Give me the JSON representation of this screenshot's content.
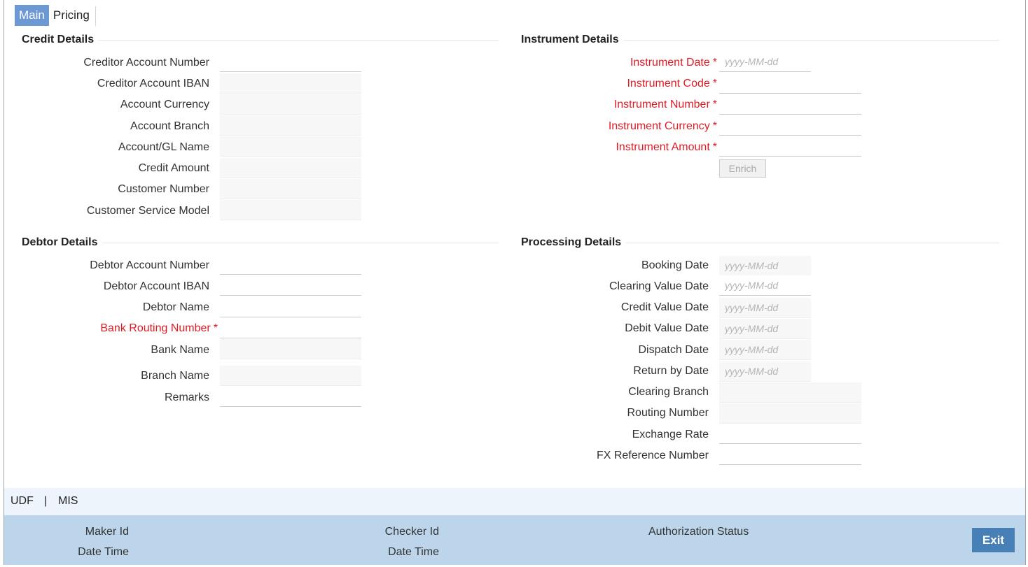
{
  "tabs": [
    {
      "label": "Main",
      "active": true
    },
    {
      "label": "Pricing",
      "active": false
    }
  ],
  "credit": {
    "title": "Credit Details",
    "fields": [
      {
        "label": "Creditor Account Number"
      },
      {
        "label": "Creditor Account IBAN"
      },
      {
        "label": "Account Currency"
      },
      {
        "label": "Account Branch"
      },
      {
        "label": "Account/GL Name"
      },
      {
        "label": "Credit Amount"
      },
      {
        "label": "Customer Number"
      },
      {
        "label": "Customer Service Model"
      }
    ]
  },
  "instrument": {
    "title": "Instrument Details",
    "required_marker": "*",
    "fields": [
      {
        "label": "Instrument Date",
        "placeholder": "yyyy-MM-dd"
      },
      {
        "label": "Instrument Code"
      },
      {
        "label": "Instrument Number"
      },
      {
        "label": "Instrument Currency"
      },
      {
        "label": "Instrument Amount"
      }
    ],
    "enrich_label": "Enrich"
  },
  "debtor": {
    "title": "Debtor Details",
    "fields": [
      {
        "label": "Debtor Account Number"
      },
      {
        "label": "Debtor Account IBAN"
      },
      {
        "label": "Debtor Name"
      },
      {
        "label": "Bank Routing Number"
      },
      {
        "label": "Bank Name"
      },
      {
        "label": "Branch Name"
      },
      {
        "label": "Remarks"
      }
    ]
  },
  "processing": {
    "title": "Processing Details",
    "fields": [
      {
        "label": "Booking Date",
        "placeholder": "yyyy-MM-dd"
      },
      {
        "label": "Clearing Value Date",
        "placeholder": "yyyy-MM-dd"
      },
      {
        "label": "Credit Value Date",
        "placeholder": "yyyy-MM-dd"
      },
      {
        "label": "Debit Value Date",
        "placeholder": "yyyy-MM-dd"
      },
      {
        "label": "Dispatch Date",
        "placeholder": "yyyy-MM-dd"
      },
      {
        "label": "Return by Date",
        "placeholder": "yyyy-MM-dd"
      },
      {
        "label": "Clearing Branch"
      },
      {
        "label": "Routing Number"
      },
      {
        "label": "Exchange Rate"
      },
      {
        "label": "FX Reference Number"
      }
    ]
  },
  "links": {
    "udf": "UDF",
    "separator": "|",
    "mis": "MIS"
  },
  "audit": {
    "maker_id": "Maker Id",
    "maker_date": "Date Time",
    "checker_id": "Checker Id",
    "checker_date": "Date Time",
    "auth_status": "Authorization Status",
    "exit_label": "Exit"
  },
  "colors": {
    "accent": "#6c98d3",
    "required": "#e01b24",
    "footer": "#bcd5ea",
    "exit_button": "#4680b6"
  }
}
